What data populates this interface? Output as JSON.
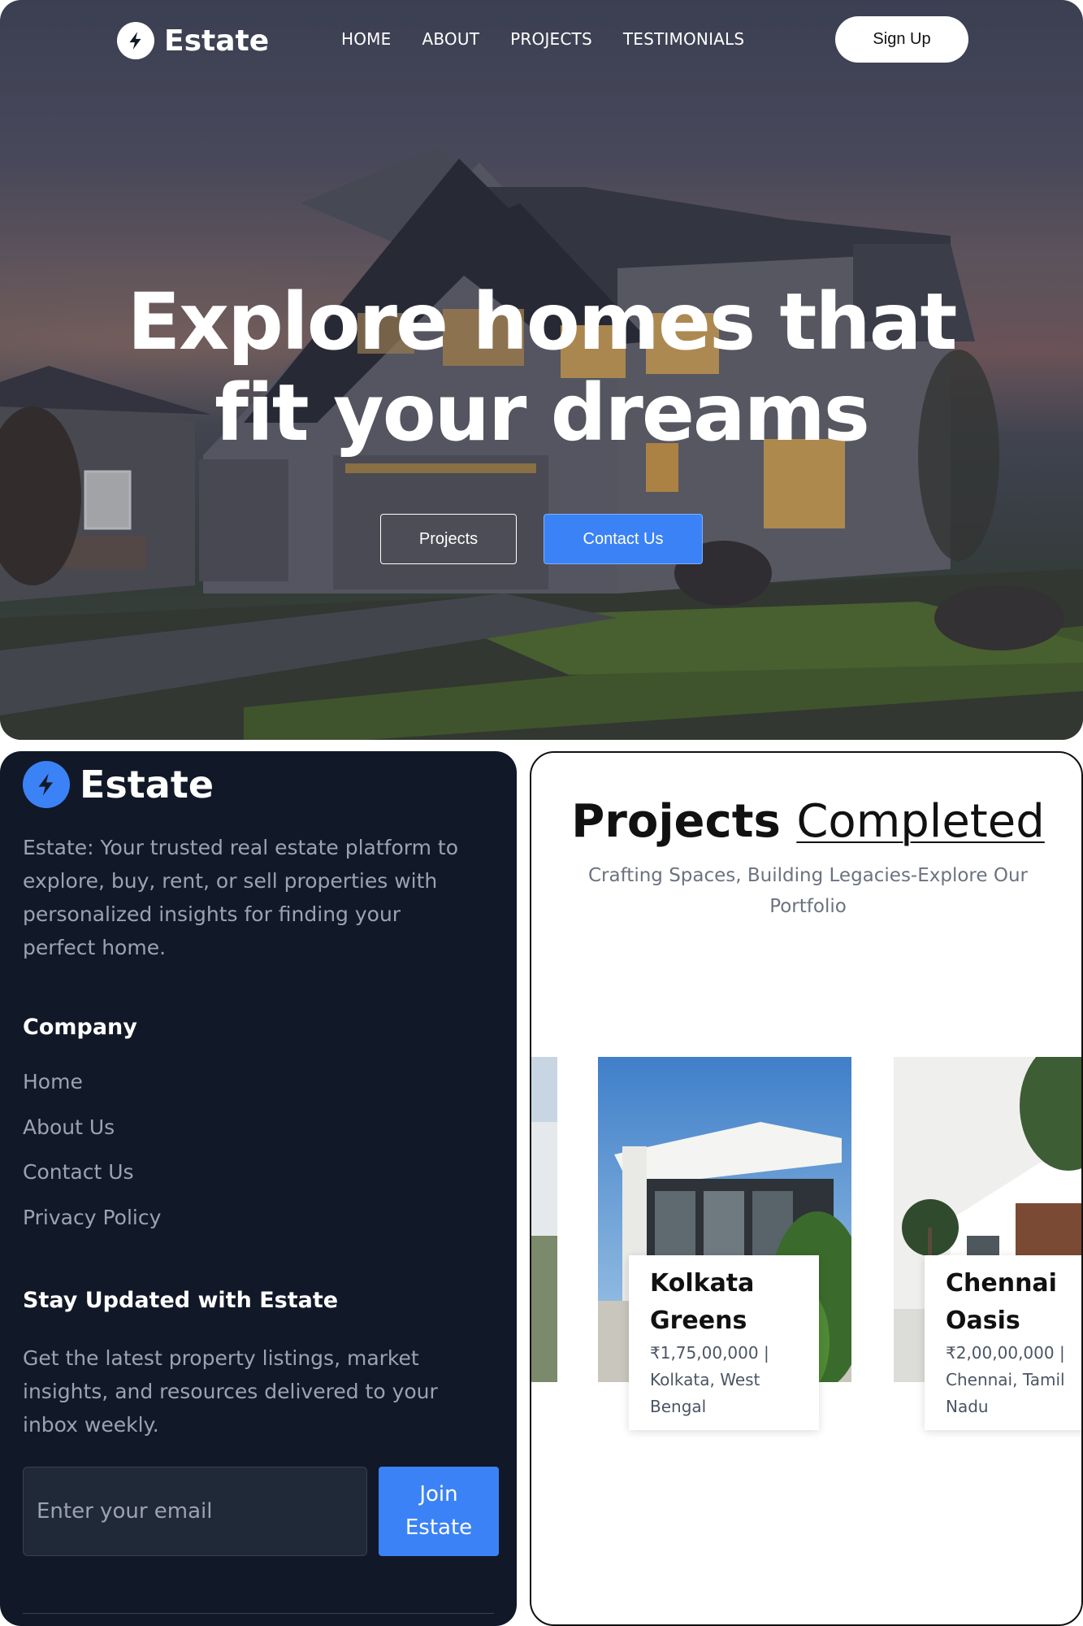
{
  "brand": {
    "name": "Estate",
    "accent": "#3b82f6"
  },
  "nav": {
    "links": [
      "HOME",
      "ABOUT",
      "PROJECTS",
      "TESTIMONIALS"
    ],
    "signup_label": "Sign Up"
  },
  "hero": {
    "title_line1": "Explore homes that",
    "title_line2": "fit your dreams",
    "projects_button": "Projects",
    "contact_button": "Contact Us"
  },
  "footer": {
    "description": "Estate: Your trusted real estate platform to explore, buy, rent, or sell properties with personalized insights for finding your perfect home.",
    "company_heading": "Company",
    "company_links": [
      "Home",
      "About Us",
      "Contact Us",
      "Privacy Policy"
    ],
    "newsletter_heading": "Stay Updated with Estate",
    "newsletter_description": "Get the latest property listings, market insights, and resources delivered to your inbox weekly.",
    "email_placeholder": "Enter your email",
    "join_label_line1": "Join",
    "join_label_line2": "Estate"
  },
  "projects": {
    "title_bold": "Projects",
    "title_light": "Completed",
    "subtitle": "Crafting Spaces, Building Legacies-Explore Our Portfolio",
    "cards": [
      {
        "name": "Kolkata Greens",
        "price": "₹1,75,00,000",
        "location": "Kolkata, West Bengal"
      },
      {
        "name": "Chennai Oasis",
        "price": "₹2,00,00,000",
        "location": "Chennai, Tamil Nadu"
      }
    ]
  }
}
